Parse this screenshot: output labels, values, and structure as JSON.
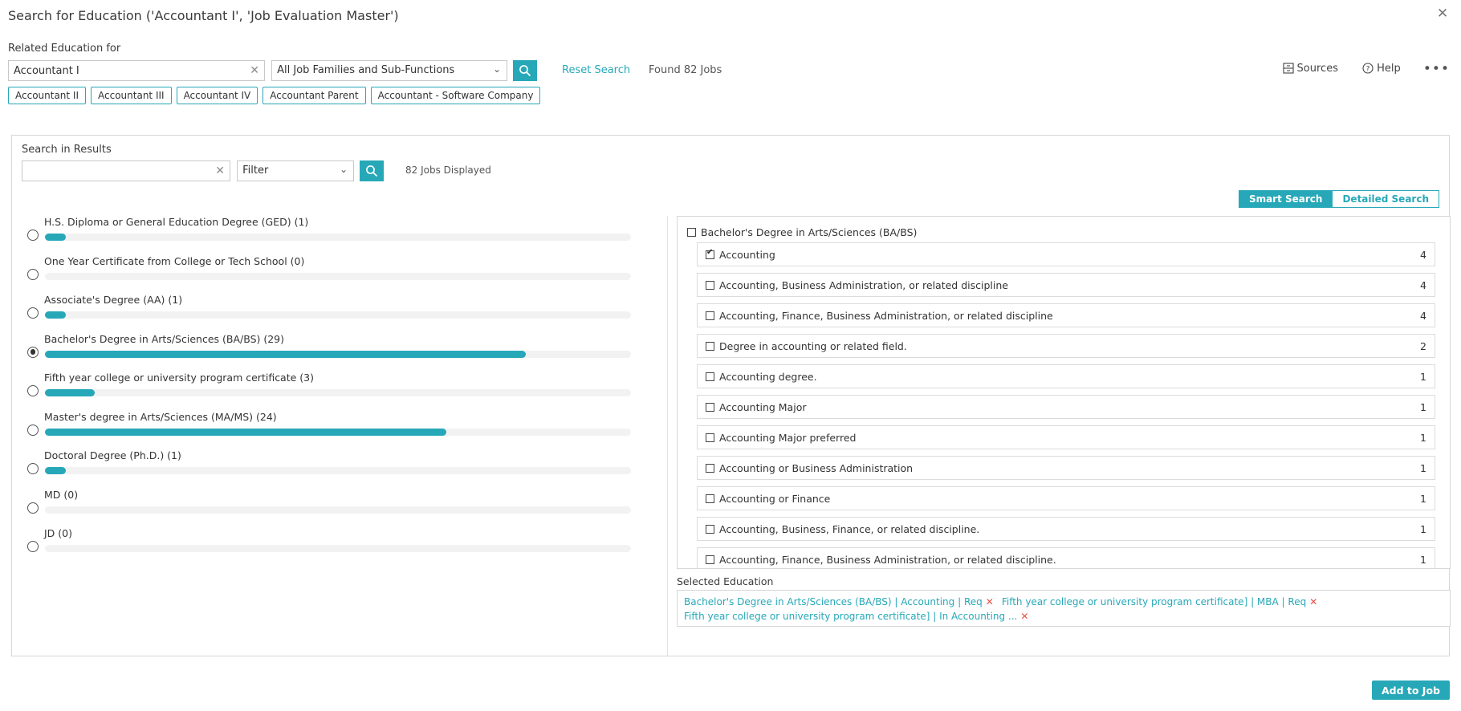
{
  "window": {
    "title": "Search for Education ('Accountant I', 'Job Evaluation Master')",
    "close_icon": "close-icon"
  },
  "header": {
    "related_label": "Related Education for",
    "job_input_value": "Accountant I",
    "job_input_placeholder": "",
    "clear_icon": "clear-x-icon",
    "family_select_value": "All Job Families and Sub-Functions",
    "search_icon": "search-icon",
    "reset_link": "Reset Search",
    "found_text": "Found 82 Jobs",
    "chips": [
      "Accountant II",
      "Accountant III",
      "Accountant IV",
      "Accountant Parent",
      "Accountant - Software Company"
    ],
    "sources_label": "Sources",
    "help_label": "Help",
    "overflow_label": "•••"
  },
  "results": {
    "search_in_results_label": "Search in Results",
    "search_value": "",
    "search_placeholder": "",
    "filter_select_value": "Filter",
    "jobs_displayed": "82 Jobs Displayed",
    "tabs": [
      {
        "label": "Smart Search",
        "active": true
      },
      {
        "label": "Detailed Search",
        "active": false
      }
    ]
  },
  "accent_color": "#27a8b8",
  "chart_data": {
    "type": "bar",
    "title": "Education level distribution",
    "orientation": "horizontal",
    "categories": [
      "H.S. Diploma or General Education Degree (GED)",
      "One Year Certificate from College or Tech School",
      "Associate's Degree (AA)",
      "Bachelor's Degree in Arts/Sciences (BA/BS)",
      "Fifth year college or university program certificate",
      "Master's degree in Arts/Sciences (MA/MS)",
      "Doctoral Degree (Ph.D.)",
      "MD",
      "JD"
    ],
    "values": [
      1,
      0,
      1,
      29,
      3,
      24,
      1,
      0,
      0
    ],
    "bar_percent": [
      3.5,
      0,
      3.5,
      82,
      8.5,
      68.5,
      3.5,
      0,
      0
    ],
    "selected_index": 3,
    "xlabel": "",
    "ylabel": "",
    "grid": false
  },
  "education_levels": [
    {
      "label": "H.S. Diploma or General Education Degree (GED) (1)",
      "pct": 3.5,
      "selected": false
    },
    {
      "label": "One Year Certificate from College or Tech School (0)",
      "pct": 0,
      "selected": false
    },
    {
      "label": "Associate's Degree (AA) (1)",
      "pct": 3.5,
      "selected": false
    },
    {
      "label": "Bachelor's Degree in Arts/Sciences (BA/BS) (29)",
      "pct": 82,
      "selected": true
    },
    {
      "label": "Fifth year college or university program certificate (3)",
      "pct": 8.5,
      "selected": false
    },
    {
      "label": "Master's degree in Arts/Sciences (MA/MS) (24)",
      "pct": 68.5,
      "selected": false
    },
    {
      "label": "Doctoral Degree (Ph.D.) (1)",
      "pct": 3.5,
      "selected": false
    },
    {
      "label": "MD (0)",
      "pct": 0,
      "selected": false
    },
    {
      "label": "JD (0)",
      "pct": 0,
      "selected": false
    }
  ],
  "detail": {
    "group_header": "Bachelor's Degree in Arts/Sciences (BA/BS)",
    "group_checked": false,
    "items": [
      {
        "label": "Accounting",
        "count": "4",
        "checked": true
      },
      {
        "label": "Accounting, Business Administration,  or related discipline",
        "count": "4",
        "checked": false
      },
      {
        "label": "Accounting, Finance, Business Administration, or related discipline",
        "count": "4",
        "checked": false
      },
      {
        "label": "Degree in accounting or related field.",
        "count": "2",
        "checked": false
      },
      {
        "label": "Accounting degree.",
        "count": "1",
        "checked": false
      },
      {
        "label": "Accounting Major",
        "count": "1",
        "checked": false
      },
      {
        "label": "Accounting Major preferred",
        "count": "1",
        "checked": false
      },
      {
        "label": "Accounting or Business Administration",
        "count": "1",
        "checked": false
      },
      {
        "label": "Accounting or Finance",
        "count": "1",
        "checked": false
      },
      {
        "label": "Accounting, Business, Finance, or related discipline.",
        "count": "1",
        "checked": false
      },
      {
        "label": "Accounting, Finance, Business Administration, or related discipline.",
        "count": "1",
        "checked": false
      }
    ]
  },
  "selected_education": {
    "label": "Selected Education",
    "tags": [
      "Bachelor's Degree in Arts/Sciences (BA/BS) | Accounting | Req",
      "Fifth year college or university program certificate] | MBA | Req",
      "Fifth year college or university program certificate] | In Accounting ..."
    ],
    "remove_icon": "remove-x-icon"
  },
  "footer": {
    "add_to_job_label": "Add to Job"
  }
}
